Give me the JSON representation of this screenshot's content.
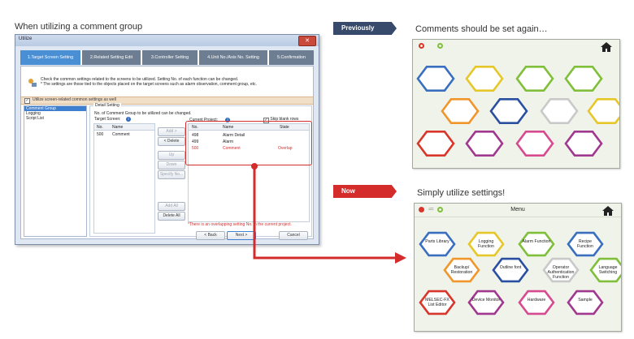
{
  "left_heading": "When utilizing a comment group",
  "previously_tag": "Previously",
  "now_tag": "Now",
  "prev_heading": "Comments should be set again…",
  "now_heading": "Simply utilize settings!",
  "dialog": {
    "title": "Utilize",
    "close_label": "✕",
    "steps": [
      "1.Target Screen Setting",
      "2.Related Setting Edit",
      "3.Controller Setting",
      "4.Unit No./Axis No. Setting",
      "5.Confirmation"
    ],
    "info_line1": "Check the common settings related to the screens to be utilized. Setting No. of each function can be changed.",
    "info_line2": "* The settings are those tied to the objects placed on the target screens such as alarm observation, comment group, etc.",
    "section_label": "Utilize screen-related common settings as well",
    "side_items": [
      "Comment Group",
      "Logging",
      "Script List"
    ],
    "detail_title": "Detail Setting",
    "change_note": "No. of Comment Group to be utilized can be changed.",
    "target_label": "Target Screen:",
    "current_label": "Current Project:",
    "skip_label": "Skip blank rows",
    "target_headers": [
      "No.",
      "Name"
    ],
    "target_rows": [
      [
        "500",
        "Comment"
      ]
    ],
    "current_headers": [
      "No.",
      "Name",
      "State"
    ],
    "current_rows": [
      {
        "no": "498",
        "name": "Alarm Detail",
        "state": ""
      },
      {
        "no": "499",
        "name": "Alarm",
        "state": ""
      },
      {
        "no": "500",
        "name": "Comment",
        "state": "Overlap"
      }
    ],
    "middle_buttons": [
      "Add >",
      "< Delete",
      "Up",
      "Down",
      "Specify No...",
      "Add All",
      "Delete All"
    ],
    "overlap_note": "*There is an overlapping setting No. in the current project.",
    "back_label": "< Back",
    "next_label": "Next >",
    "cancel_label": "Cancel"
  },
  "now_screen": {
    "title": "Menu",
    "buttons": [
      "Parts Library",
      "Logging Function",
      "Alarm Function",
      "Recipe Function",
      "Backup/ Restoration",
      "Outline font",
      "Operator Authentication Function",
      "Language Switching",
      "MELSEC-FX List Editor",
      "Device Monitor",
      "Hardware",
      "Sample"
    ]
  },
  "colors": {
    "prev_hexes": [
      "#3a6fc0",
      "#e6c72a",
      "#7fbf3a",
      "#7fbf3a",
      "#f0962a",
      "#2a4fa0",
      "#c9c9c9",
      "#e6c72a",
      "#d9362b",
      "#a0388f",
      "#d64b8f",
      "#a0388f"
    ],
    "now_hexes": [
      "#3a6fc0",
      "#e6c72a",
      "#7fbf3a",
      "#3a6fc0",
      "#f0962a",
      "#2a4fa0",
      "#c9c9c9",
      "#7fbf3a",
      "#d9362b",
      "#a0388f",
      "#d64b8f",
      "#a0388f"
    ],
    "arrow": "#d42b2b"
  },
  "icons": [
    "home-icon",
    "info-icon",
    "close-icon"
  ]
}
